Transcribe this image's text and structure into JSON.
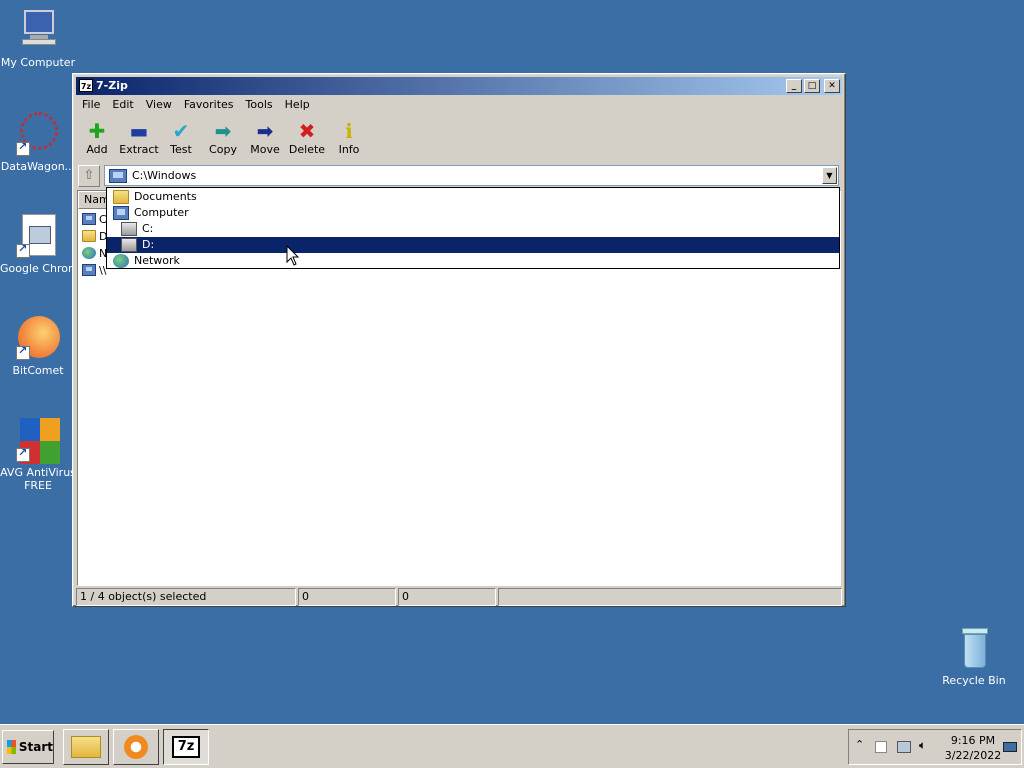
{
  "desktop": {
    "icons": [
      {
        "label": "My Computer"
      },
      {
        "label": "DataWagon..."
      },
      {
        "label": "Google Chrome"
      },
      {
        "label": "BitComet"
      },
      {
        "label": "AVG AntiVirus FREE"
      },
      {
        "label": "Recycle Bin"
      }
    ]
  },
  "window": {
    "title": "7-Zip",
    "menu": [
      "File",
      "Edit",
      "View",
      "Favorites",
      "Tools",
      "Help"
    ],
    "toolbar": [
      {
        "label": "Add",
        "icon": "plus-icon",
        "color": "#1ea51e"
      },
      {
        "label": "Extract",
        "icon": "minus-icon",
        "color": "#1f3fa0"
      },
      {
        "label": "Test",
        "icon": "check-icon",
        "color": "#2aa6c9"
      },
      {
        "label": "Copy",
        "icon": "copy-arrow-icon",
        "color": "#1f8f8f"
      },
      {
        "label": "Move",
        "icon": "move-arrow-icon",
        "color": "#1c2f8f"
      },
      {
        "label": "Delete",
        "icon": "x-icon",
        "color": "#d22020"
      },
      {
        "label": "Info",
        "icon": "info-icon",
        "color": "#c8b400"
      }
    ],
    "address": "C:\\Windows",
    "list": {
      "column_name": "Name",
      "rows": [
        {
          "label": "C"
        },
        {
          "label": "D"
        },
        {
          "label": "N"
        },
        {
          "label": "\\\\"
        }
      ]
    },
    "status": {
      "selection": "1 / 4 object(s) selected",
      "size": "0",
      "packed": "0",
      "extra": ""
    }
  },
  "dropdown": {
    "items": [
      {
        "label": "Documents",
        "icon": "folder-icon",
        "indent": 0
      },
      {
        "label": "Computer",
        "icon": "computer-icon",
        "indent": 0
      },
      {
        "label": "C:",
        "icon": "drive-icon",
        "indent": 1
      },
      {
        "label": "D:",
        "icon": "drive-icon",
        "indent": 1,
        "selected": true
      },
      {
        "label": "Network",
        "icon": "network-icon",
        "indent": 0
      }
    ]
  },
  "taskbar": {
    "start_label": "Start",
    "clock_time": "9:16 PM",
    "clock_date": "3/22/2022"
  }
}
